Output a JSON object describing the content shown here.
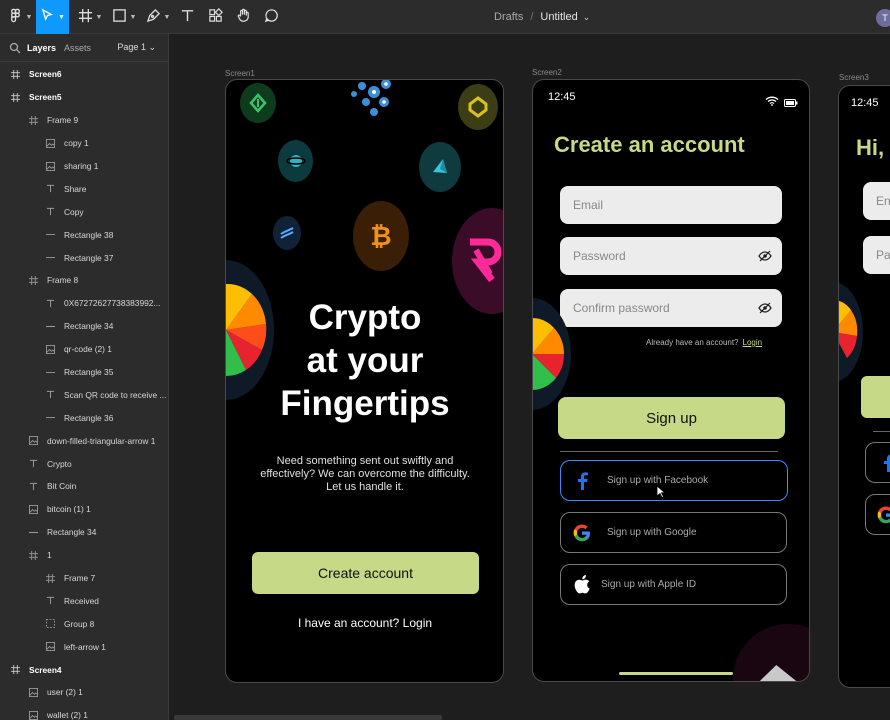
{
  "toolbar": {
    "breadcrumb_project": "Drafts",
    "breadcrumb_sep": "/",
    "file_name": "Untitled",
    "caret": "⌄",
    "avatar_initial": "T",
    "icons": [
      "figma-menu-icon",
      "move-tool-icon",
      "frame-tool-icon",
      "shape-tool-icon",
      "pen-tool-icon",
      "text-tool-icon",
      "components-icon",
      "hand-tool-icon",
      "comment-icon"
    ]
  },
  "panel": {
    "tab_layers": "Layers",
    "tab_assets": "Assets",
    "page": "Page 1 ⌄",
    "layers": [
      {
        "name": "Screen6",
        "kind": "frame",
        "level": 0
      },
      {
        "name": "Screen5",
        "kind": "frame",
        "level": 0
      },
      {
        "name": "Frame 9",
        "kind": "frame",
        "level": 1
      },
      {
        "name": "copy 1",
        "kind": "image",
        "level": 2
      },
      {
        "name": "sharing 1",
        "kind": "image",
        "level": 2
      },
      {
        "name": "Share",
        "kind": "text",
        "level": 2
      },
      {
        "name": "Copy",
        "kind": "text",
        "level": 2
      },
      {
        "name": "Rectangle 38",
        "kind": "rect",
        "level": 2
      },
      {
        "name": "Rectangle 37",
        "kind": "rect",
        "level": 2
      },
      {
        "name": "Frame 8",
        "kind": "frame",
        "level": 1
      },
      {
        "name": "0X67272627738383992...",
        "kind": "text",
        "level": 2
      },
      {
        "name": "Rectangle 34",
        "kind": "line",
        "level": 2
      },
      {
        "name": "qr-code (2) 1",
        "kind": "image",
        "level": 2
      },
      {
        "name": "Rectangle 35",
        "kind": "rect",
        "level": 2
      },
      {
        "name": "Scan QR code to receive ...",
        "kind": "text",
        "level": 2
      },
      {
        "name": "Rectangle 36",
        "kind": "rect",
        "level": 2
      },
      {
        "name": "down-filled-triangular-arrow 1",
        "kind": "image",
        "level": 1
      },
      {
        "name": "Crypto",
        "kind": "text",
        "level": 1
      },
      {
        "name": "Bit Coin",
        "kind": "text",
        "level": 1
      },
      {
        "name": "bitcoin (1) 1",
        "kind": "image",
        "level": 1
      },
      {
        "name": "Rectangle 34",
        "kind": "line",
        "level": 1
      },
      {
        "name": "1",
        "kind": "frame",
        "level": 1
      },
      {
        "name": "Frame 7",
        "kind": "frame",
        "level": 2
      },
      {
        "name": "Received",
        "kind": "text",
        "level": 2
      },
      {
        "name": "Group 8",
        "kind": "group",
        "level": 2
      },
      {
        "name": "left-arrow 1",
        "kind": "image",
        "level": 2
      },
      {
        "name": "Screen4",
        "kind": "frame",
        "level": 0
      },
      {
        "name": "user (2) 1",
        "kind": "image",
        "level": 1
      },
      {
        "name": "wallet (2) 1",
        "kind": "image",
        "level": 1
      }
    ]
  },
  "canvas": {
    "screen1": {
      "label": "Screen1",
      "hero_line1": "Crypto",
      "hero_line2": "at your",
      "hero_line3": "Fingertips",
      "subtext": "Need something sent out swiftly and effectively? We can overcome the difficulty. Let us handle it.",
      "create_button": "Create account",
      "login_link": "I have an account? Login"
    },
    "screen2": {
      "label": "Screen2",
      "time": "12:45",
      "heading": "Create an account",
      "email_placeholder": "Email",
      "password_placeholder": "Password",
      "confirm_placeholder": "Confirm password",
      "already_text": "Already have an account?",
      "login_text": "Login",
      "signup_button": "Sign up",
      "facebook_button": "Sign up with Facebook",
      "google_button": "Sign up with Google",
      "apple_button": "Sign up with Apple ID"
    },
    "screen3": {
      "label": "Screen3",
      "time": "12:45",
      "heading_partial": "Hi, W",
      "field1_partial": "En",
      "field2_partial": "Pa"
    }
  },
  "colors": {
    "accent_green": "#c5d987",
    "selection_blue": "#0d99ff",
    "canvas_bg": "#1e1e1e",
    "panel_bg": "#2c2c2c"
  }
}
